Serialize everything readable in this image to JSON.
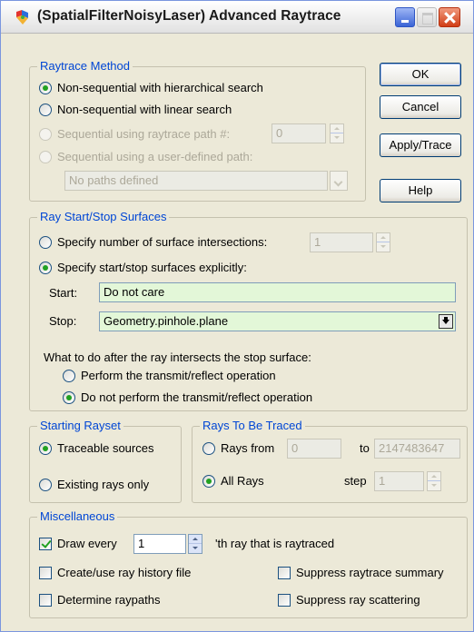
{
  "window": {
    "title": "(SpatialFilterNoisyLaser) Advanced Raytrace"
  },
  "buttons": {
    "ok": "OK",
    "cancel": "Cancel",
    "apply": "Apply/Trace",
    "help": "Help"
  },
  "raytrace_method": {
    "title": "Raytrace Method",
    "options": [
      {
        "label": "Non-sequential with hierarchical search",
        "checked": true,
        "enabled": true
      },
      {
        "label": "Non-sequential with linear search",
        "checked": false,
        "enabled": true
      },
      {
        "label": "Sequential using raytrace path #:",
        "checked": false,
        "enabled": false
      },
      {
        "label": "Sequential using a user-defined path:",
        "checked": false,
        "enabled": false
      }
    ],
    "path_number": "0",
    "paths_dropdown": "No paths defined"
  },
  "ray_start_stop": {
    "title": "Ray Start/Stop Surfaces",
    "option_number": "Specify number of surface intersections:",
    "intersections_value": "1",
    "option_explicit": "Specify start/stop surfaces explicitly:",
    "start_label": "Start:",
    "start_value": "Do not care",
    "stop_label": "Stop:",
    "stop_value": "Geometry.pinhole.plane",
    "after_question": "What to do after the ray intersects the stop surface:",
    "after_options": [
      {
        "label": "Perform the transmit/reflect operation",
        "checked": false
      },
      {
        "label": "Do not perform the transmit/reflect operation",
        "checked": true
      }
    ]
  },
  "starting_rayset": {
    "title": "Starting Rayset",
    "options": [
      {
        "label": "Traceable sources",
        "checked": true
      },
      {
        "label": "Existing rays only",
        "checked": false
      }
    ]
  },
  "rays_to_trace": {
    "title": "Rays To Be Traced",
    "rays_from_label": "Rays from",
    "rays_from_value": "0",
    "to_label": "to",
    "to_value": "2147483647",
    "all_rays_label": "All Rays",
    "step_label": "step",
    "step_value": "1",
    "selected": "All Rays"
  },
  "miscellaneous": {
    "title": "Miscellaneous",
    "draw_every_label": "Draw every",
    "draw_every_value": "1",
    "draw_every_suffix": "'th ray that is raytraced",
    "draw_every_checked": true,
    "ray_history": {
      "label": "Create/use ray history file",
      "checked": false
    },
    "raypaths": {
      "label": "Determine raypaths",
      "checked": false
    },
    "suppress_summary": {
      "label": "Suppress raytrace summary",
      "checked": false
    },
    "suppress_scattering": {
      "label": "Suppress ray scattering",
      "checked": false
    }
  },
  "colors": {
    "group_title": "#0046d5",
    "radio_checked": "#21a121",
    "field_highlight": "#e3f7d8",
    "dialog_background": "#ece9d8"
  }
}
